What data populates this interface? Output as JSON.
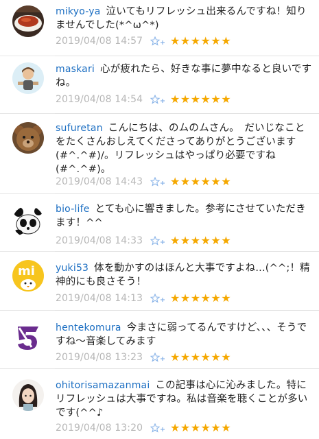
{
  "comments": [
    {
      "user": "mikyo-ya",
      "text": "泣いてもリフレッシュ出来るんですね！知りませんでした(*^ω^*)",
      "date": "2019/04/08 14:57",
      "stars": "★★★★★★",
      "avatar": "food-photo-avatar"
    },
    {
      "user": "maskari",
      "text": "心が疲れたら、好きな事に夢中なると良いですね。",
      "date": "2019/04/08 14:54",
      "stars": "★★★★★★",
      "avatar": "person-illustration-avatar"
    },
    {
      "user": "sufuretan",
      "text": "こんにちは、のムのムさん。　だいじなことをたくさんおしえてくださってありがとうございます(#^.^#)/。リフレッシュはやっぱり必要ですね(#^.^#)。",
      "date": "2019/04/08 14:43",
      "stars": "★★★★★★",
      "avatar": "teddy-bear-avatar"
    },
    {
      "user": "bio-life",
      "text": "とても心に響きました。参考にさせていただきます！^^",
      "date": "2019/04/08 14:33",
      "stars": "★★★★★★",
      "avatar": "panda-avatar"
    },
    {
      "user": "yuki53",
      "text": "体を動かすのはほんと大事ですよね...(^^;！精神的にも良さそう！",
      "date": "2019/04/08 14:13",
      "stars": "★★★★★★",
      "avatar": "yellow-mi-avatar"
    },
    {
      "user": "hentekomura",
      "text": "今まさに弱ってるんですけど、、、そうですね〜音楽してみます",
      "date": "2019/04/08 13:23",
      "stars": "★★★★★★",
      "avatar": "purple-logo-avatar"
    },
    {
      "user": "ohitorisamazanmai",
      "text": "この記事は心に沁みました。特にリフレッシュは大事ですね。私は音楽を聴くことが多いです(^^♪",
      "date": "2019/04/08 13:20",
      "stars": "★★★★★★",
      "avatar": "girl-illustration-avatar"
    }
  ],
  "colors": {
    "username": "#1b6ec2",
    "date": "#b7b7b7",
    "star": "#f5a800",
    "star_outline": "#8ab4e8"
  }
}
